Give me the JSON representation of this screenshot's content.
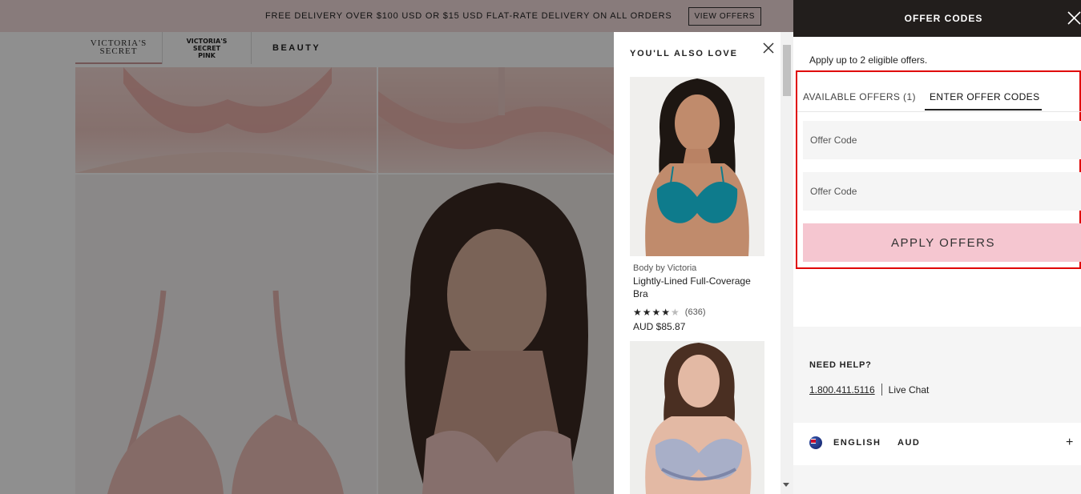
{
  "promo": {
    "text": "FREE DELIVERY OVER $100 USD OR $15 USD FLAT-RATE DELIVERY ON ALL ORDERS",
    "button": "VIEW OFFERS"
  },
  "brands": {
    "vs_line1": "VICTORIA'S",
    "vs_line2": "SECRET",
    "pink_line1": "VICTORIA'S SECRET",
    "pink_line2": "PINK",
    "beauty": "BEAUTY"
  },
  "recommendations": {
    "title": "YOU'LL ALSO LOVE",
    "product": {
      "brand": "Body by Victoria",
      "name": "Lightly-Lined Full-Coverage Bra",
      "rating_count": "(636)",
      "price": "AUD $85.87",
      "stars": 4
    }
  },
  "drawer": {
    "title": "OFFER CODES",
    "apply_note": "Apply up to 2 eligible offers.",
    "tabs": [
      "AVAILABLE OFFERS (1)",
      "ENTER OFFER CODES"
    ],
    "code_placeholder_1": "Offer Code",
    "code_placeholder_2": "Offer Code",
    "apply_button": "APPLY OFFERS",
    "help_title": "NEED HELP?",
    "phone": "1.800.411.5116",
    "live_chat": "Live Chat",
    "language": "ENGLISH",
    "currency": "AUD"
  },
  "colors": {
    "header_dark": "#221e1c",
    "apply_button_pink": "#f5c6d0",
    "highlight_red": "#e00000",
    "promo_pink": "#f3dcdc"
  }
}
